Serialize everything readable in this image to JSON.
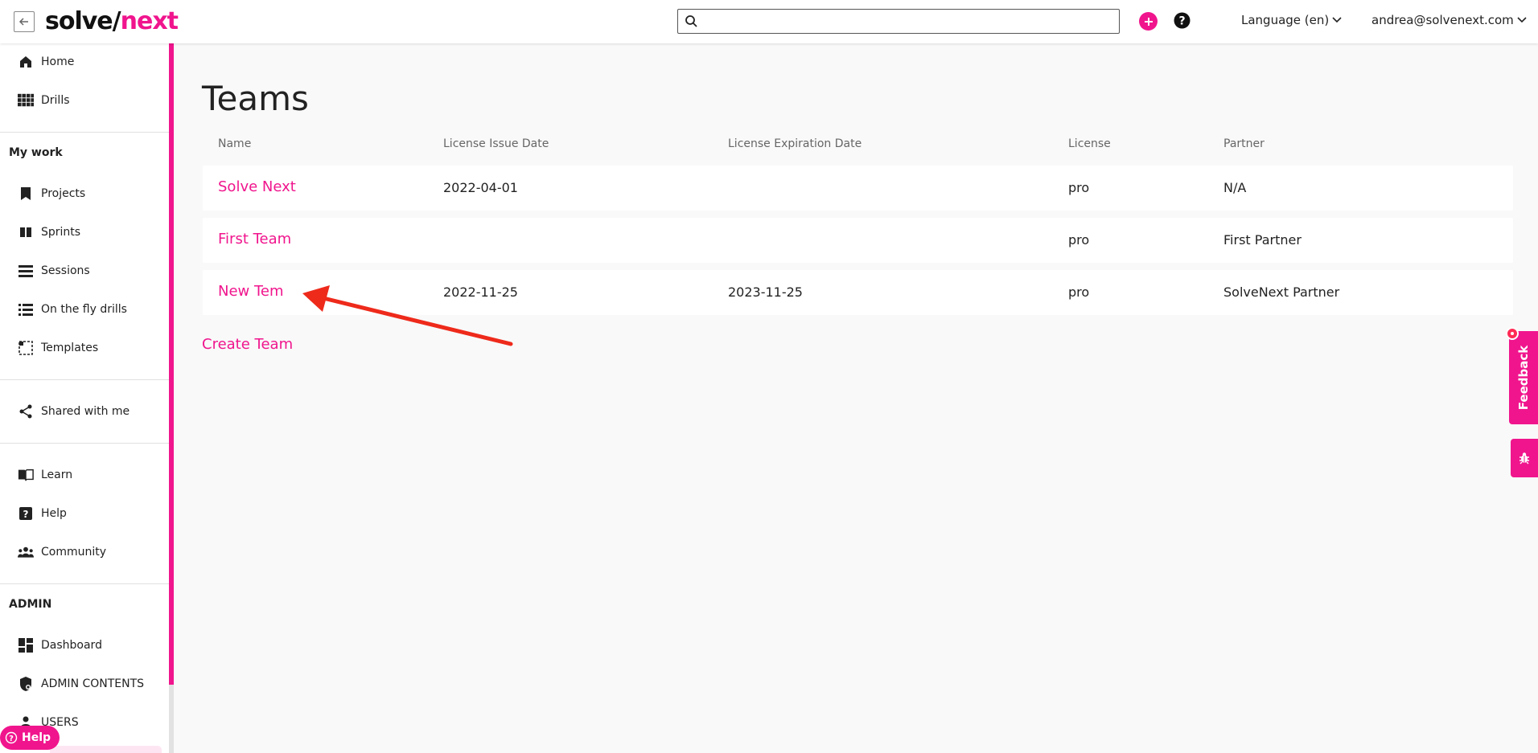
{
  "brand": {
    "part1": "solve/",
    "part2": "next"
  },
  "header": {
    "search_placeholder": "",
    "language_label": "Language (en)",
    "user_email": "andrea@solvenext.com"
  },
  "sidebar": {
    "top_items": [
      {
        "label": "Home",
        "icon": "home-icon"
      },
      {
        "label": "Drills",
        "icon": "grid-icon"
      }
    ],
    "my_work_title": "My work",
    "work_items": [
      {
        "label": "Projects",
        "icon": "bookmark-icon"
      },
      {
        "label": "Sprints",
        "icon": "columns-icon"
      },
      {
        "label": "Sessions",
        "icon": "list-icon"
      },
      {
        "label": "On the fly drills",
        "icon": "list-bullets-icon"
      },
      {
        "label": "Templates",
        "icon": "template-icon"
      }
    ],
    "shared_label": "Shared with me",
    "learn_items": [
      {
        "label": "Learn",
        "icon": "book-icon"
      },
      {
        "label": "Help",
        "icon": "question-icon"
      },
      {
        "label": "Community",
        "icon": "people-icon"
      }
    ],
    "admin_title": "ADMIN",
    "admin_items": [
      {
        "label": "Dashboard",
        "icon": "dashboard-icon"
      },
      {
        "label": "ADMIN CONTENTS",
        "icon": "shield-icon"
      },
      {
        "label": "USERS",
        "icon": "users-icon"
      }
    ],
    "help_pill": "Help"
  },
  "main": {
    "title": "Teams",
    "columns": [
      "Name",
      "License Issue Date",
      "License Expiration Date",
      "License",
      "Partner"
    ],
    "rows": [
      {
        "name": "Solve Next",
        "issue": "2022-04-01",
        "expiration": "",
        "license": "pro",
        "partner": "N/A"
      },
      {
        "name": "First Team",
        "issue": "",
        "expiration": "",
        "license": "pro",
        "partner": "First Partner"
      },
      {
        "name": "New Tem",
        "issue": "2022-11-25",
        "expiration": "2023-11-25",
        "license": "pro",
        "partner": "SolveNext Partner"
      }
    ],
    "create_label": "Create Team"
  },
  "feedback": {
    "label": "Feedback"
  },
  "colors": {
    "accent": "#f0158d",
    "arrow": "#ee2a1b"
  }
}
